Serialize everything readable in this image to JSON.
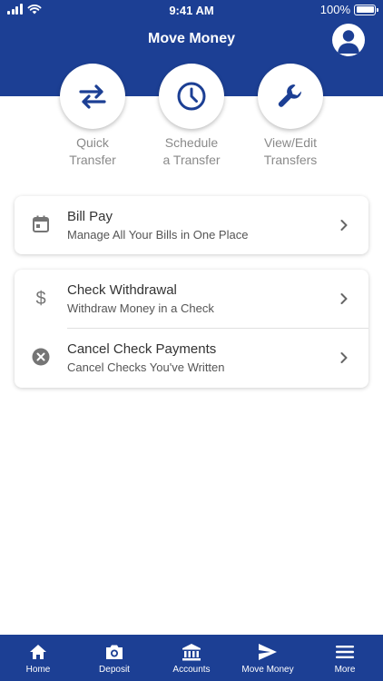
{
  "status_bar": {
    "time": "9:41 AM",
    "battery": "100%"
  },
  "header": {
    "title": "Move Money"
  },
  "quick_actions": [
    {
      "line1": "Quick",
      "line2": "Transfer",
      "icon": "transfer-arrows-icon"
    },
    {
      "line1": "Schedule",
      "line2": "a Transfer",
      "icon": "clock-icon"
    },
    {
      "line1": "View/Edit",
      "line2": "Transfers",
      "icon": "wrench-icon"
    }
  ],
  "cards": [
    {
      "items": [
        {
          "title": "Bill Pay",
          "subtitle": "Manage All Your Bills in One Place",
          "icon": "calendar-icon"
        }
      ]
    },
    {
      "items": [
        {
          "title": "Check Withdrawal",
          "subtitle": "Withdraw Money in a Check",
          "icon": "dollar-icon"
        },
        {
          "title": "Cancel Check Payments",
          "subtitle": "Cancel Checks You've Written",
          "icon": "cancel-circle-icon"
        }
      ]
    }
  ],
  "bottom_nav": [
    {
      "label": "Home",
      "icon": "home-icon"
    },
    {
      "label": "Deposit",
      "icon": "camera-icon"
    },
    {
      "label": "Accounts",
      "icon": "bank-icon"
    },
    {
      "label": "Move Money",
      "icon": "send-icon",
      "active": true
    },
    {
      "label": "More",
      "icon": "menu-icon"
    }
  ],
  "colors": {
    "brand": "#1c3f94",
    "muted_text": "#8a8a8a",
    "icon_gray": "#757575"
  }
}
